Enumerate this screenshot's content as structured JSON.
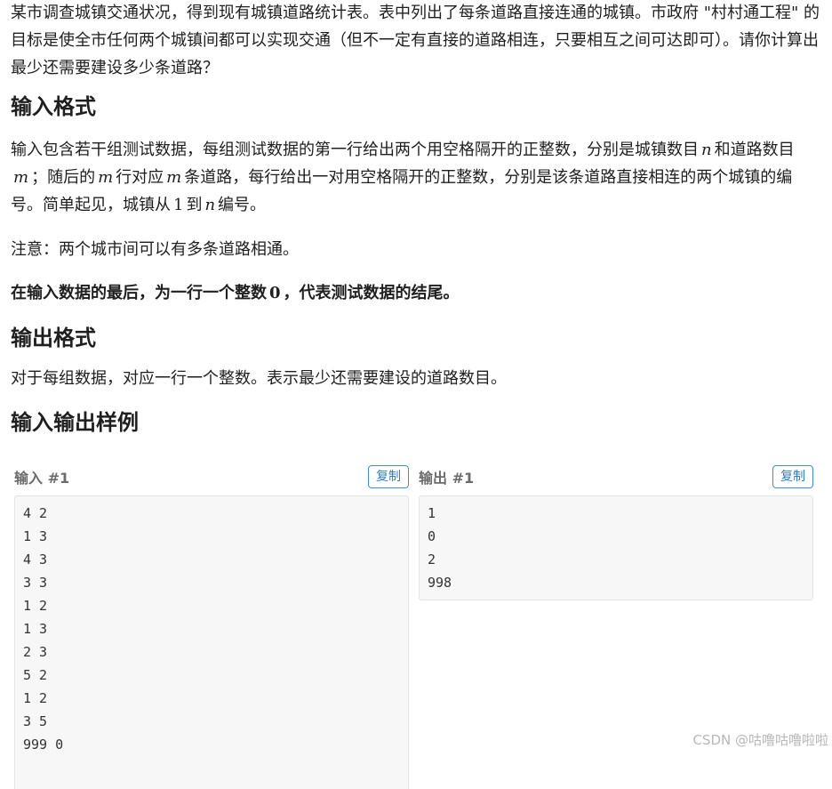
{
  "intro": "某市调查城镇交通状况，得到现有城镇道路统计表。表中列出了每条道路直接连通的城镇。市政府 \"村村通工程\" 的目标是使全市任何两个城镇间都可以实现交通（但不一定有直接的道路相连，只要相互之间可达即可）。请你计算出最少还需要建设多少条道路？",
  "input_heading": "输入格式",
  "input_desc": {
    "part1": "输入包含若干组测试数据，每组测试数据的第一行给出两个用空格隔开的正整数，分别是城镇数目",
    "var_n": "n",
    "part2": "和道路数目",
    "var_m": "m",
    "part3": "；随后的",
    "var_m2": "m",
    "part4": "行对应",
    "var_m3": "m",
    "part5": "条道路，每行给出一对用空格隔开的正整数，分别是该条道路直接相连的两个城镇的编号。简单起见，城镇从",
    "num_1": "1",
    "part6": "到",
    "var_n2": "n",
    "part7": "编号。"
  },
  "note": "注意：两个城市间可以有多条道路相通。",
  "bold_note": {
    "part1": "在输入数据的最后，为一行一个整数",
    "num_0": "0",
    "part2": "，代表测试数据的结尾。"
  },
  "output_heading": "输出格式",
  "output_desc": "对于每组数据，对应一行一个整数。表示最少还需要建设的道路数目。",
  "samples_heading": "输入输出样例",
  "sample_input": {
    "title": "输入 #1",
    "copy_label": "复制",
    "lines": [
      "4 2",
      "1 3",
      "4 3",
      "3 3",
      "1 2",
      "1 3",
      "2 3",
      "5 2",
      "1 2",
      "3 5",
      "999 0"
    ]
  },
  "sample_output": {
    "title": "输出 #1",
    "copy_label": "复制",
    "lines": [
      "1",
      "0",
      "2",
      "998"
    ]
  },
  "watermark": "CSDN @咕噜咕噜啦啦",
  "colors": {
    "copy_button_border": "#3e8fd6",
    "sample_bg": "#f7f7f7",
    "sample_title": "#6b6b6b"
  }
}
